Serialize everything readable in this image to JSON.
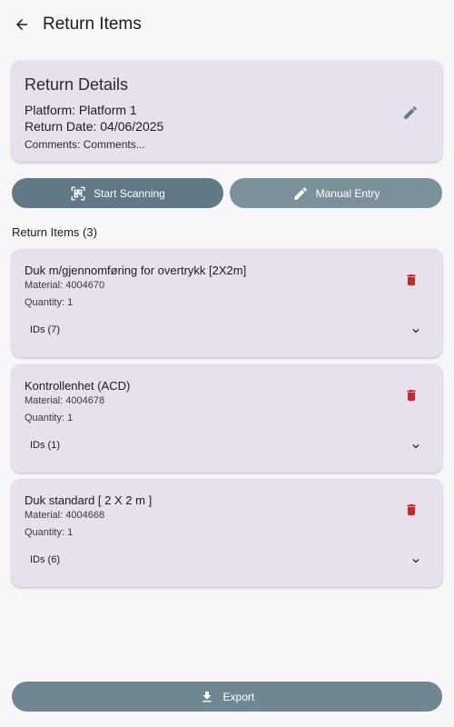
{
  "header": {
    "back_icon": "arrow-back-icon",
    "title": "Return Items"
  },
  "details": {
    "title": "Return Details",
    "platform": "Platform: Platform 1",
    "return_date": "Return Date: 04/06/2025",
    "comments": "Comments: Comments...",
    "edit_icon": "pencil-icon"
  },
  "actions": {
    "scan_label": "Start Scanning",
    "scan_icon": "qr-scan-icon",
    "manual_label": "Manual Entry",
    "manual_icon": "pencil-icon"
  },
  "items_section": {
    "title": "Return Items (3)"
  },
  "items": [
    {
      "name": "Duk m/gjennomføring for overtrykk [2X2m]",
      "material": "Material: 4004670",
      "quantity": "Quantity: 1",
      "ids_label": "IDs (7)"
    },
    {
      "name": "Kontrollenhet (ACD)",
      "material": "Material: 4004678",
      "quantity": "Quantity: 1",
      "ids_label": "IDs (1)"
    },
    {
      "name": "Duk standard [ 2 X 2 m ]",
      "material": "Material: 4004668",
      "quantity": "Quantity: 1",
      "ids_label": "IDs (6)"
    }
  ],
  "footer": {
    "export_label": "Export",
    "export_icon": "download-icon"
  },
  "colors": {
    "card_bg": "#e8e0ec",
    "primary_button": "#5f7986",
    "secondary_button": "#7a909b",
    "export_button": "#6f8793",
    "delete_red": "#c62828",
    "edit_icon": "#5f7986"
  }
}
